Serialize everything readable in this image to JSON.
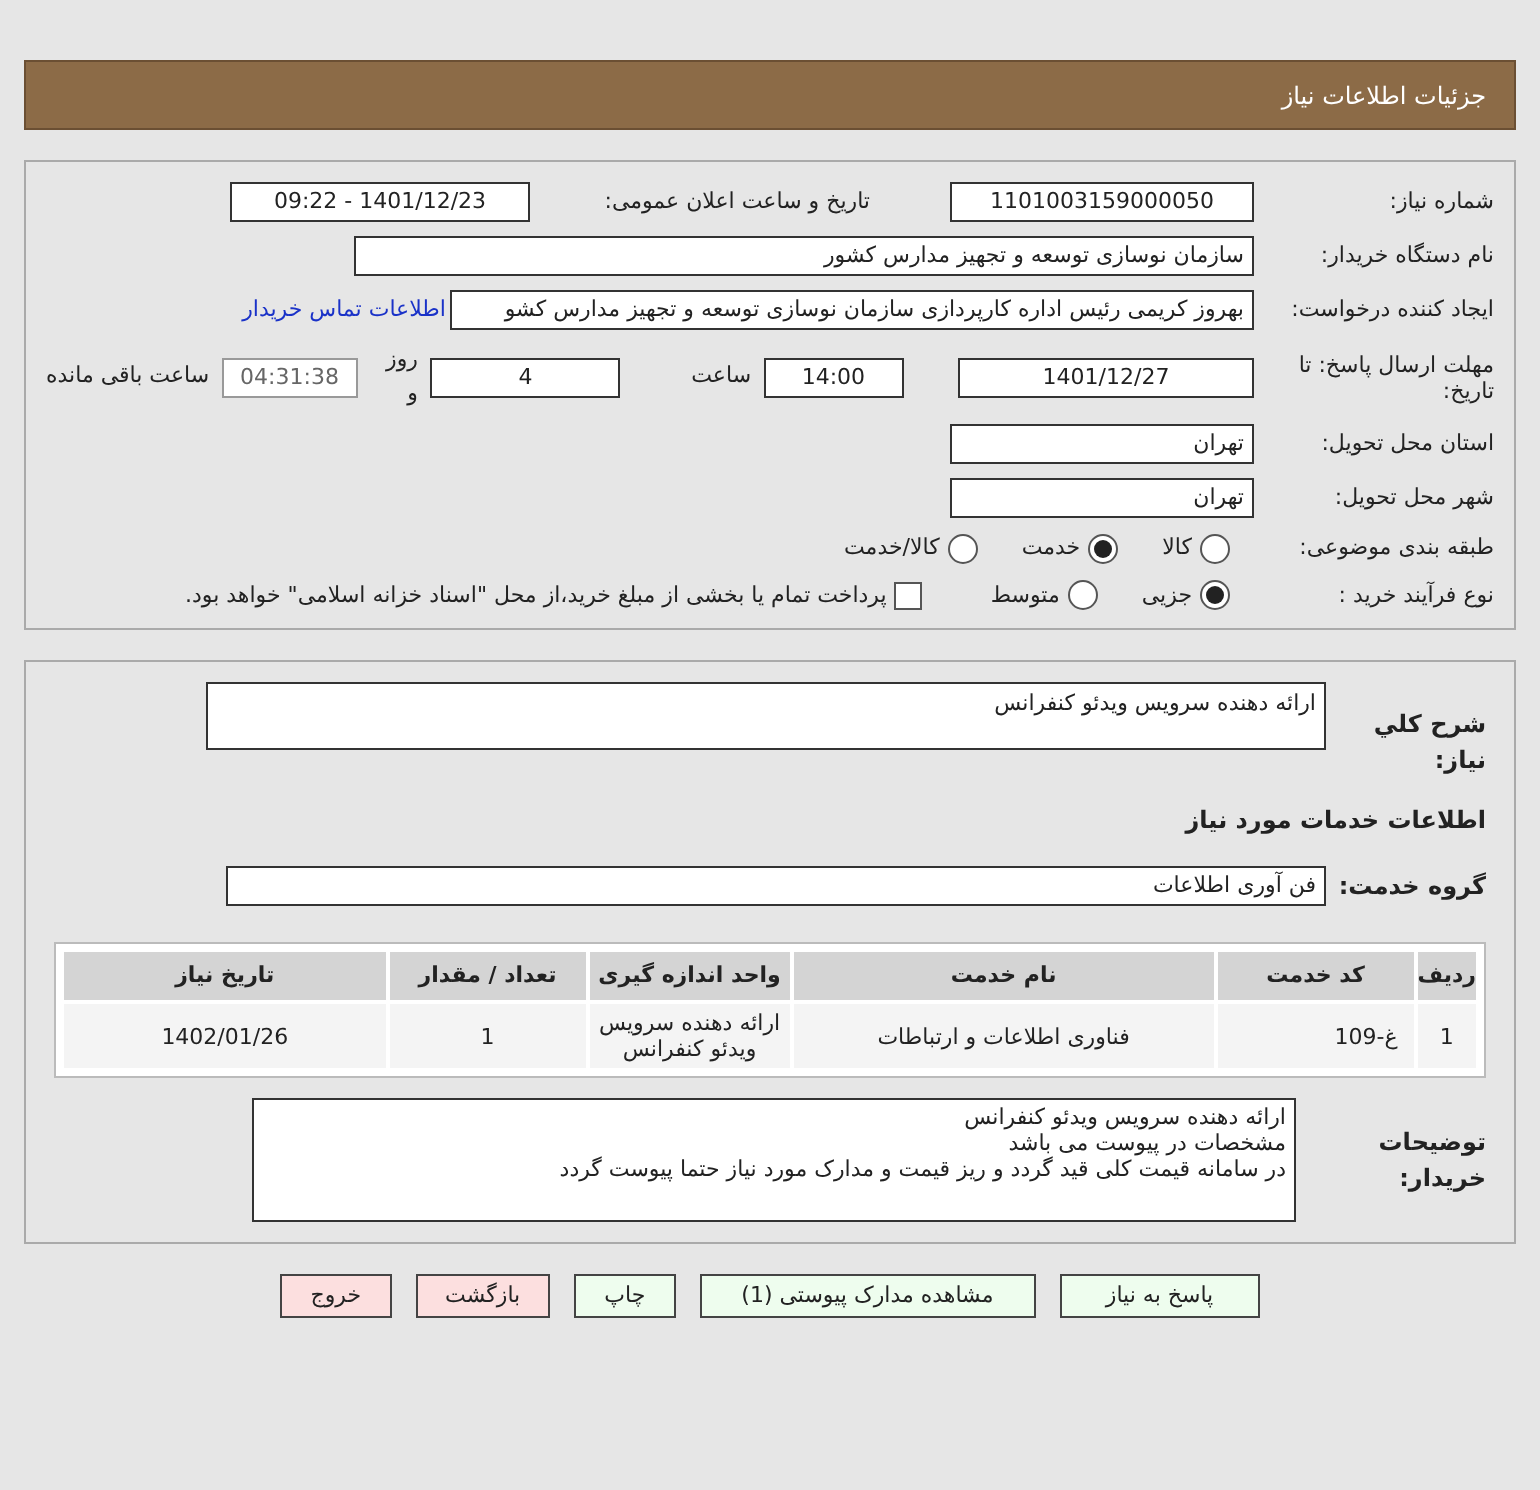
{
  "header": {
    "title": "جزئیات اطلاعات نیاز"
  },
  "need_number": {
    "label": "شماره نیاز:",
    "value": "1101003159000050"
  },
  "announce": {
    "label": "تاریخ و ساعت اعلان عمومی:",
    "value": "1401/12/23 - 09:22"
  },
  "buyer_org": {
    "label": "نام دستگاه خریدار:",
    "value": "سازمان نوسازی  توسعه و تجهیز مدارس کشور"
  },
  "requester": {
    "label": "ایجاد کننده درخواست:",
    "value": "بهروز کریمی رئیس اداره کارپردازی سازمان نوسازی  توسعه و تجهیز مدارس کشو",
    "link": "اطلاعات تماس خریدار"
  },
  "deadline": {
    "label": "مهلت ارسال پاسخ: تا تاریخ:",
    "date": "1401/12/27",
    "time_label": "ساعت",
    "time": "14:00",
    "days": "4",
    "days_label": "روز و",
    "remaining": "04:31:38",
    "remaining_label": "ساعت باقی مانده"
  },
  "province": {
    "label": "استان محل تحویل:",
    "value": "تهران"
  },
  "city": {
    "label": "شهر محل تحویل:",
    "value": "تهران"
  },
  "category": {
    "label": "طبقه بندی موضوعی:",
    "options": [
      {
        "label": "کالا",
        "selected": false
      },
      {
        "label": "خدمت",
        "selected": true
      },
      {
        "label": "کالا/خدمت",
        "selected": false
      }
    ]
  },
  "purchase_type": {
    "label": "نوع فرآیند خرید :",
    "options": [
      {
        "label": "جزیی",
        "selected": true
      },
      {
        "label": "متوسط",
        "selected": false
      }
    ],
    "treasury": {
      "label": "پرداخت تمام یا بخشی از مبلغ خرید،از محل \"اسناد خزانه اسلامی\" خواهد بود.",
      "checked": false
    }
  },
  "description": {
    "label": "شرح كلي نياز:",
    "value": "ارائه دهنده سرویس ویدئو کنفرانس"
  },
  "services_title": "اطلاعات خدمات مورد نیاز",
  "service_group": {
    "label": "گروه خدمت:",
    "value": "فن آوری اطلاعات"
  },
  "table": {
    "columns": [
      "ردیف",
      "کد خدمت",
      "نام خدمت",
      "واحد اندازه گیری",
      "تعداد / مقدار",
      "تاریخ نیاز"
    ],
    "rows": [
      [
        "1",
        "غ-109",
        "فناوری اطلاعات و ارتباطات",
        "ارائه دهنده سرویس ویدئو کنفرانس",
        "1",
        "1402/01/26"
      ]
    ]
  },
  "buyer_notes": {
    "label": "توضیحات خریدار:",
    "lines": [
      "ارائه دهنده سرویس ویدئو کنفرانس",
      "مشخصات در پیوست می باشد",
      "در سامانه قیمت کلی قید گردد و ریز قیمت و مدارک مورد نیاز حتما پیوست گردد"
    ]
  },
  "buttons": [
    {
      "label": "پاسخ به نیاز",
      "kind": "green"
    },
    {
      "label": "مشاهده مدارک پیوستی (1)",
      "kind": "green"
    },
    {
      "label": "چاپ",
      "kind": "green"
    },
    {
      "label": "بازگشت",
      "kind": "red"
    },
    {
      "label": "خروج",
      "kind": "red"
    }
  ]
}
